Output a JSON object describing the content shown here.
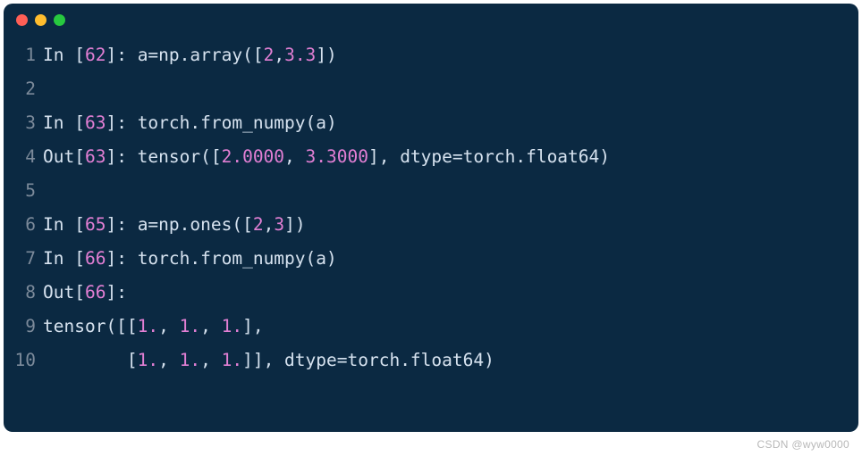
{
  "watermark": "CSDN @wyw0000",
  "lines": [
    {
      "n": "1",
      "tokens": [
        {
          "t": "In ",
          "c": "ident"
        },
        {
          "t": "[",
          "c": "bracket"
        },
        {
          "t": "62",
          "c": "num"
        },
        {
          "t": "]: a=np.array([",
          "c": "ident"
        },
        {
          "t": "2",
          "c": "num"
        },
        {
          "t": ",",
          "c": "ident"
        },
        {
          "t": "3.3",
          "c": "num"
        },
        {
          "t": "])",
          "c": "ident"
        }
      ]
    },
    {
      "n": "2",
      "tokens": []
    },
    {
      "n": "3",
      "tokens": [
        {
          "t": "In ",
          "c": "ident"
        },
        {
          "t": "[",
          "c": "bracket"
        },
        {
          "t": "63",
          "c": "num"
        },
        {
          "t": "]: torch.from_numpy(a)",
          "c": "ident"
        }
      ]
    },
    {
      "n": "4",
      "tokens": [
        {
          "t": "Out[",
          "c": "ident"
        },
        {
          "t": "63",
          "c": "num"
        },
        {
          "t": "]: tensor([",
          "c": "ident"
        },
        {
          "t": "2.0000",
          "c": "num"
        },
        {
          "t": ", ",
          "c": "ident"
        },
        {
          "t": "3.3000",
          "c": "num"
        },
        {
          "t": "], dtype=torch.float64)",
          "c": "ident"
        }
      ]
    },
    {
      "n": "5",
      "tokens": []
    },
    {
      "n": "6",
      "tokens": [
        {
          "t": "In ",
          "c": "ident"
        },
        {
          "t": "[",
          "c": "bracket"
        },
        {
          "t": "65",
          "c": "num"
        },
        {
          "t": "]: a=np.ones([",
          "c": "ident"
        },
        {
          "t": "2",
          "c": "num"
        },
        {
          "t": ",",
          "c": "ident"
        },
        {
          "t": "3",
          "c": "num"
        },
        {
          "t": "])",
          "c": "ident"
        }
      ]
    },
    {
      "n": "7",
      "tokens": [
        {
          "t": "In ",
          "c": "ident"
        },
        {
          "t": "[",
          "c": "bracket"
        },
        {
          "t": "66",
          "c": "num"
        },
        {
          "t": "]: torch.from_numpy(a)",
          "c": "ident"
        }
      ]
    },
    {
      "n": "8",
      "tokens": [
        {
          "t": "Out[",
          "c": "ident"
        },
        {
          "t": "66",
          "c": "num"
        },
        {
          "t": "]:",
          "c": "ident"
        }
      ]
    },
    {
      "n": "9",
      "tokens": [
        {
          "t": "tensor([[",
          "c": "ident"
        },
        {
          "t": "1.",
          "c": "num"
        },
        {
          "t": ", ",
          "c": "ident"
        },
        {
          "t": "1.",
          "c": "num"
        },
        {
          "t": ", ",
          "c": "ident"
        },
        {
          "t": "1.",
          "c": "num"
        },
        {
          "t": "],",
          "c": "ident"
        }
      ]
    },
    {
      "n": "10",
      "tokens": [
        {
          "t": "        [",
          "c": "ident"
        },
        {
          "t": "1.",
          "c": "num"
        },
        {
          "t": ", ",
          "c": "ident"
        },
        {
          "t": "1.",
          "c": "num"
        },
        {
          "t": ", ",
          "c": "ident"
        },
        {
          "t": "1.",
          "c": "num"
        },
        {
          "t": "]], dtype=torch.float64)",
          "c": "ident"
        }
      ]
    }
  ]
}
